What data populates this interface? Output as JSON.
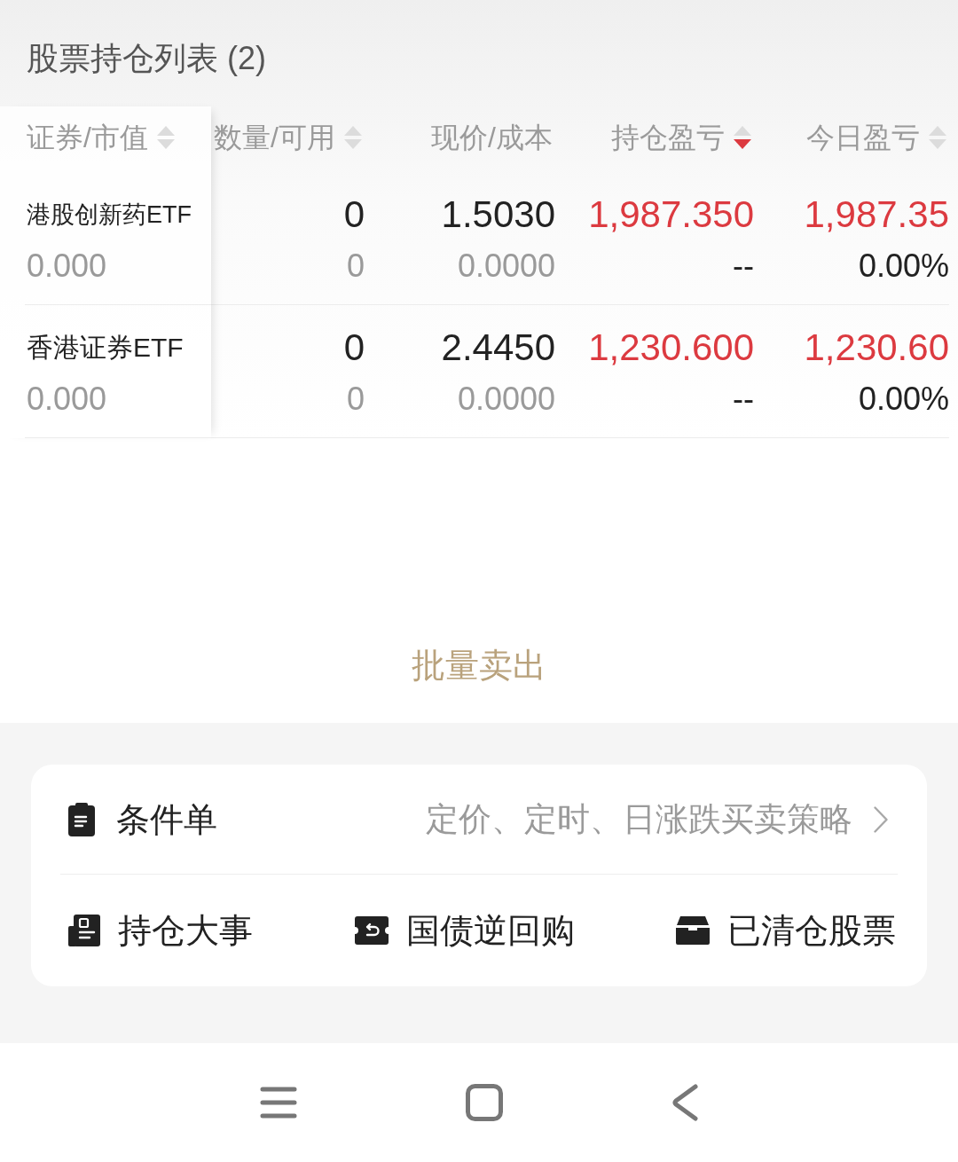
{
  "holdings": {
    "title": "股票持仓列表 (2)",
    "columns": [
      {
        "label": "证券/市值",
        "sortable": true,
        "sort_descending": false
      },
      {
        "label": "数量/可用",
        "sortable": true,
        "sort_descending": false
      },
      {
        "label": "现价/成本",
        "sortable": false
      },
      {
        "label": "持仓盈亏",
        "sortable": true,
        "sort_descending": true
      },
      {
        "label": "今日盈亏",
        "sortable": true,
        "sort_descending": false
      }
    ],
    "rows": [
      {
        "name": "港股创新药ETF",
        "market_value": "0.000",
        "quantity": "0",
        "available": "0",
        "price": "1.5030",
        "cost": "0.0000",
        "position_pnl": {
          "text": "1,987.350",
          "positive": true
        },
        "position_pnl_ratio": {
          "text": "--",
          "positive": false
        },
        "today_pnl": {
          "text": "1,987.35",
          "positive": true
        },
        "today_pnl_ratio": {
          "text": "0.00%",
          "positive": false
        }
      },
      {
        "name": "香港证券ETF",
        "market_value": "0.000",
        "quantity": "0",
        "available": "0",
        "price": "2.4450",
        "cost": "0.0000",
        "position_pnl": {
          "text": "1,230.600",
          "positive": true
        },
        "position_pnl_ratio": {
          "text": "--",
          "positive": false
        },
        "today_pnl": {
          "text": "1,230.60",
          "positive": true
        },
        "today_pnl_ratio": {
          "text": "0.00%",
          "positive": false
        }
      }
    ]
  },
  "batch_sell_button": {
    "label": "批量卖出"
  },
  "tools_card": {
    "conditional_order": {
      "label": "条件单",
      "description": "定价、定时、日涨跌买卖策略"
    },
    "shortcuts": [
      {
        "kind": "events",
        "label": "持仓大事"
      },
      {
        "kind": "repo",
        "label": "国债逆回购"
      },
      {
        "kind": "cleared",
        "label": "已清仓股票"
      }
    ]
  }
}
